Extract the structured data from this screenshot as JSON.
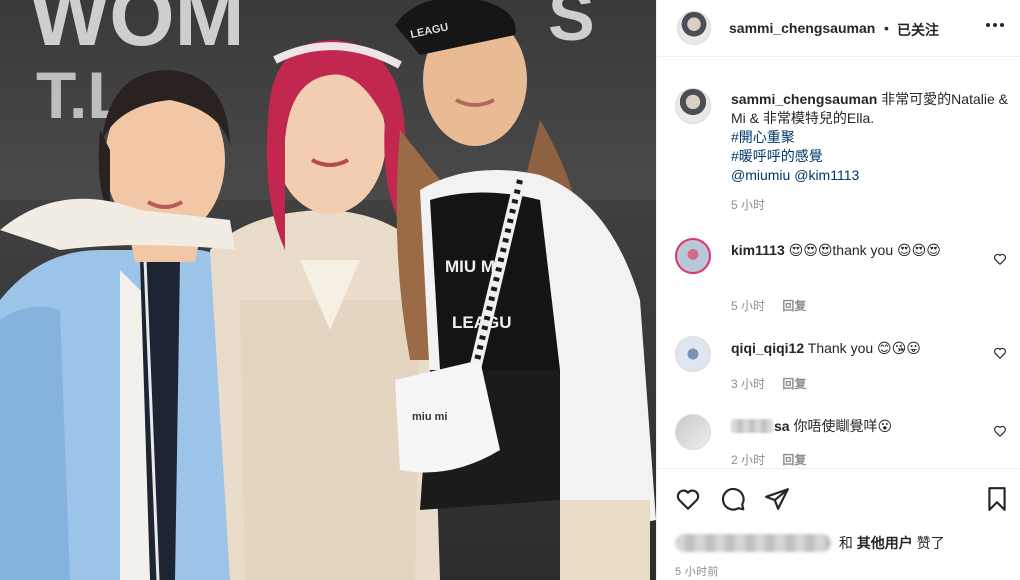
{
  "photo": {
    "alt_label": "photo-of-three-women",
    "backdrop_text": "WOM",
    "backdrop_text2": "T.L.",
    "cap_text": "LEAGU",
    "shirt_text_1": "MIU MI",
    "shirt_text_2": "LEAGU",
    "bag_text": "miu mi"
  },
  "header": {
    "username": "sammi_chengsauman",
    "dot": "•",
    "follow_label": "已关注",
    "more_icon": "more-dots-icon"
  },
  "caption": {
    "username": "sammi_chengsauman",
    "text": "非常可愛的Natalie & Mi & 非常模特兒的Ella.",
    "tag1": "#開心重聚",
    "tag2": "#暖呼呼的感覺",
    "mention1": "@miumiu",
    "mention2": "@kim1113",
    "time": "5 小时"
  },
  "comments": [
    {
      "username": "kim1113",
      "text": "😍😍😍thank you 😍😍😍",
      "time": "5 小时",
      "reply": "回复"
    },
    {
      "username": "qiqi_qiqi12",
      "text": "Thank you 😊😘😛",
      "time": "3 小时",
      "reply": "回复"
    },
    {
      "username": "sa",
      "text": "你唔使瞓覺咩😮",
      "time": "2 小时",
      "reply": "回复"
    }
  ],
  "likes": {
    "and": "和",
    "others": "其他用户",
    "liked": "赞了"
  },
  "post_time": "5 小时前",
  "colors": {
    "link": "#00376b",
    "meta": "#8e8e8e",
    "text": "#262626",
    "story_ring": "#e1306c"
  }
}
